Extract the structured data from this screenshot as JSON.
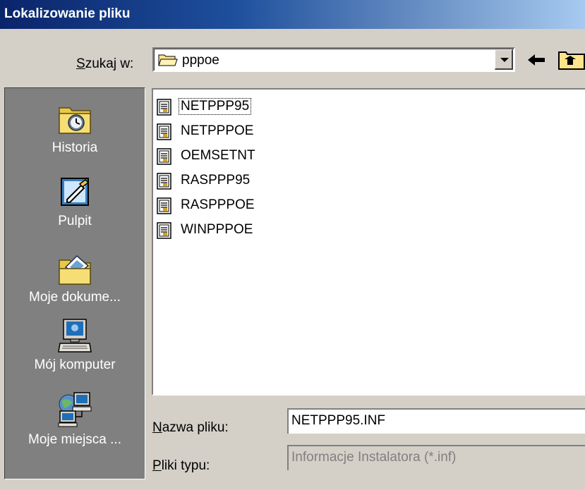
{
  "window": {
    "title": "Lokalizowanie pliku"
  },
  "lookin": {
    "label_access": "S",
    "label_rest": "zukaj w:",
    "value": "pppoe"
  },
  "toolbar": {
    "back_icon": "back-arrow-icon",
    "up_icon": "up-folder-icon"
  },
  "places": [
    {
      "label": "Historia",
      "icon": "history-icon"
    },
    {
      "label": "Pulpit",
      "icon": "desktop-icon"
    },
    {
      "label": "Moje dokume...",
      "icon": "my-documents-icon"
    },
    {
      "label": "Mój komputer",
      "icon": "my-computer-icon"
    },
    {
      "label": "Moje miejsca ...",
      "icon": "network-places-icon"
    }
  ],
  "files": [
    {
      "name": "NETPPP95",
      "selected": true
    },
    {
      "name": "NETPPPOE"
    },
    {
      "name": "OEMSETNT"
    },
    {
      "name": "RASPPP95"
    },
    {
      "name": "RASPPPOE"
    },
    {
      "name": "WINPPPOE"
    }
  ],
  "filename": {
    "label_access": "N",
    "label_rest": "azwa pliku:",
    "value": "NETPPP95.INF"
  },
  "filetype": {
    "label_access": "P",
    "label_rest": "liki typu:",
    "value": "Informacje Instalatora (*.inf)"
  },
  "colors": {
    "titlebar": "#0a246a",
    "face": "#d4d0c8",
    "places_bg": "#808080"
  }
}
